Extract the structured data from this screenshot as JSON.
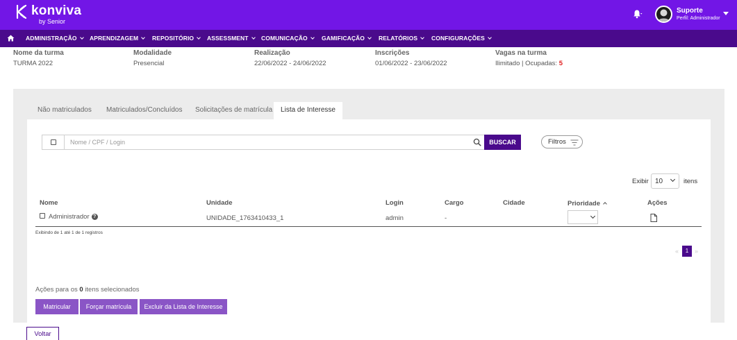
{
  "brand": {
    "name": "konviva",
    "byline": "by Senior"
  },
  "user": {
    "name": "Suporte",
    "profile": "Perfil: Administrador",
    "bell_icon": "bell-icon",
    "avatar_icon": "avatar-icon"
  },
  "nav": {
    "home_icon": "home-icon",
    "items": [
      {
        "label": "ADMINISTRAÇÃO"
      },
      {
        "label": "APRENDIZAGEM"
      },
      {
        "label": "REPOSITÓRIO"
      },
      {
        "label": "ASSESSMENT"
      },
      {
        "label": "COMUNICAÇÃO"
      },
      {
        "label": "GAMIFICAÇÃO"
      },
      {
        "label": "RELATÓRIOS"
      },
      {
        "label": "CONFIGURAÇÕES"
      }
    ]
  },
  "info": {
    "turma": {
      "label": "Nome da turma",
      "value": "TURMA 2022"
    },
    "modalidade": {
      "label": "Modalidade",
      "value": "Presencial"
    },
    "realizacao": {
      "label": "Realização",
      "value": "22/06/2022 - 24/06/2022"
    },
    "inscricoes": {
      "label": "Inscrições",
      "value": "01/06/2022 - 23/06/2022"
    },
    "vagas": {
      "label": "Vagas na turma",
      "value_prefix": "Ilimitado | Ocupadas: ",
      "occupied": "5"
    }
  },
  "tabs": [
    {
      "label": "Não matriculados"
    },
    {
      "label": "Matriculados/Concluídos"
    },
    {
      "label": "Solicitações de matrícula"
    },
    {
      "label": "Lista de Interesse",
      "active": true
    }
  ],
  "search": {
    "placeholder": "Nome / CPF / Login",
    "button": "BUSCAR",
    "filters": "Filtros"
  },
  "paging": {
    "show_label": "Exibir",
    "page_size": "10",
    "items_label": "itens",
    "current_page": "1",
    "prev": "«",
    "next": "»"
  },
  "table": {
    "headers": {
      "nome": "Nome",
      "unidade": "Unidade",
      "login": "Login",
      "cargo": "Cargo",
      "cidade": "Cidade",
      "prioridade": "Prioridade",
      "acoes": "Ações"
    },
    "rows": [
      {
        "nome": "Administrador",
        "unidade": "UNIDADE_1763410433_1",
        "login": "admin",
        "cargo": "-",
        "cidade": "",
        "prioridade": ""
      }
    ],
    "footer": "Exibindo de 1 até 1 de 1 registros"
  },
  "bulk": {
    "prefix": "Ações para os ",
    "count": "0",
    "suffix": " itens selecionados",
    "buttons": [
      "Matricular",
      "Forçar matrícula",
      "Excluir da Lista de Interesse"
    ]
  },
  "back_button": "Voltar",
  "colors": {
    "header": "#7216e6",
    "nav": "#4a0a8c",
    "action": "#8a55c6",
    "accent_red": "#e02020"
  }
}
